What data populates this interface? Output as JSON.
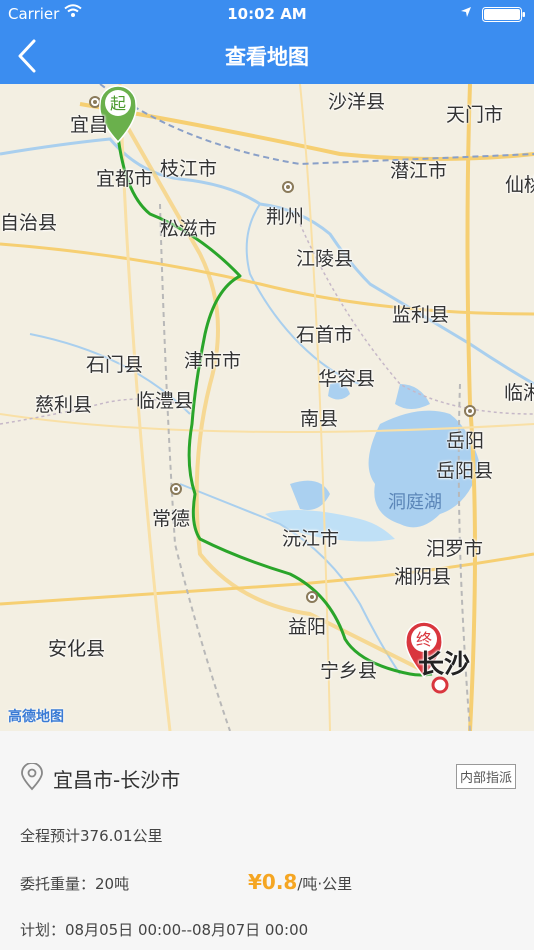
{
  "status_bar": {
    "carrier": "Carrier",
    "time": "10:02 AM"
  },
  "nav": {
    "title": "查看地图",
    "back_icon": "chevron-left-icon"
  },
  "map": {
    "start_marker": "起",
    "end_marker": "终",
    "provider_logo": "高德地图",
    "places": {
      "yichang": "宜昌",
      "yidu": "宜都市",
      "zhijiang": "枝江市",
      "shayang": "沙洋县",
      "tianmen": "天门市",
      "qianjiang": "潜江市",
      "xiantao": "仙桃",
      "zizhi": "自治县",
      "songzi": "松滋市",
      "jingzhou": "荆州",
      "jiangling": "江陵县",
      "jianli": "监利县",
      "shishou": "石首市",
      "shimen": "石门县",
      "jinshi": "津市市",
      "huarong": "华容县",
      "cili": "慈利县",
      "linli": "临澧县",
      "lin": "临湘",
      "nanxian": "南县",
      "yueyang": "岳阳",
      "yueyangxian": "岳阳县",
      "dongting": "洞庭湖",
      "changde": "常德",
      "yuanjiang": "沅江市",
      "miluo": "汨罗市",
      "xiangyin": "湘阴县",
      "yiyang": "益阳",
      "anhua": "安化县",
      "ningxiang": "宁乡县",
      "changsha": "长沙"
    }
  },
  "order": {
    "route": "宜昌市-长沙市",
    "badge": "内部指派",
    "distance": "全程预计376.01公里",
    "weight": "委托重量：20吨",
    "price_symbol": "¥",
    "price_value": "0.8",
    "price_unit": "/吨·公里",
    "schedule": "计划：08月05日 00:00--08月07日 00:00"
  },
  "colors": {
    "nav_bg": "#3b8df0",
    "route_line": "#2aa52a",
    "start_pin": "#6ab04c",
    "end_pin": "#d9363e",
    "price": "#f5a623"
  }
}
